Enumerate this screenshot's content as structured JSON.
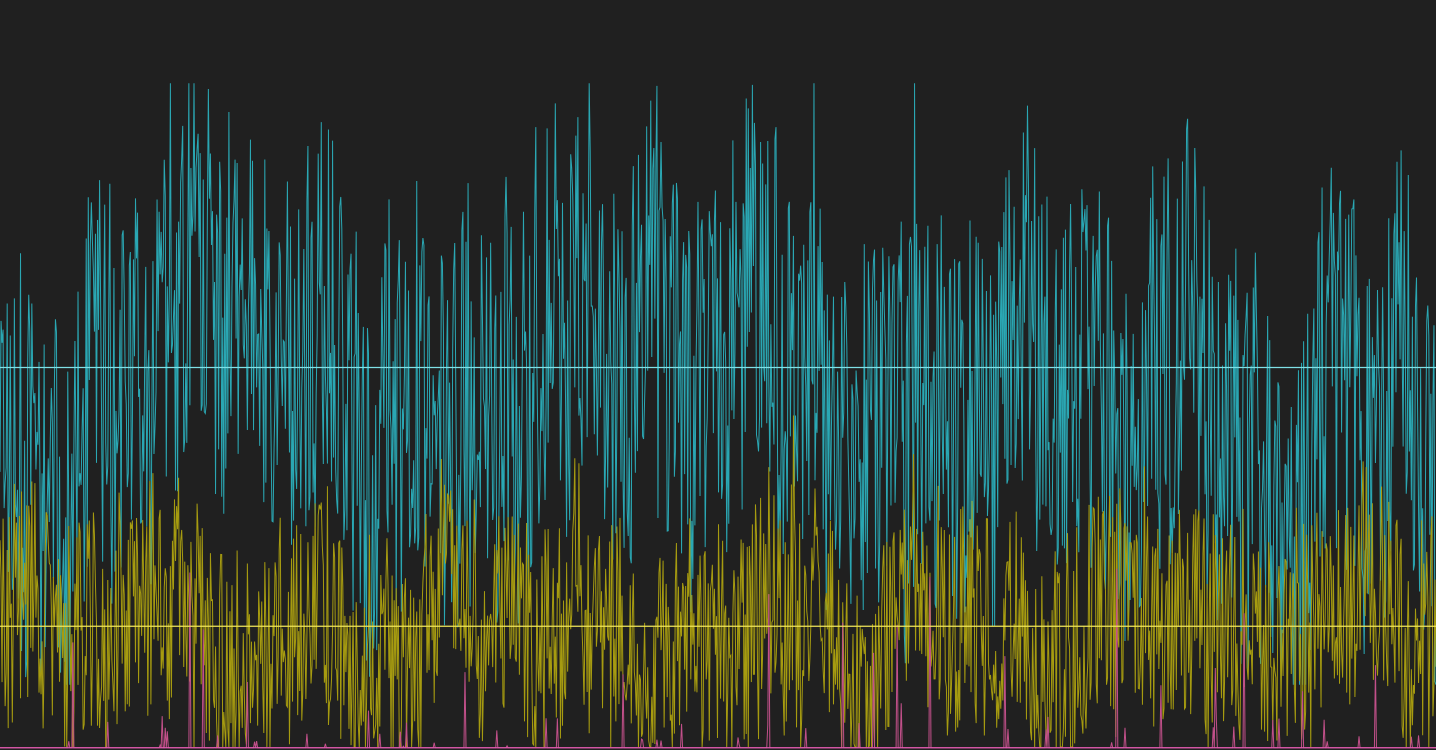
{
  "chart_data": {
    "type": "line",
    "title": "",
    "xlabel": "",
    "ylabel": "",
    "grid": false,
    "legend": "none",
    "background": "#202020",
    "x_range": [
      0,
      1000
    ],
    "ylim": [
      0,
      100
    ],
    "series": [
      {
        "color": "#2aa7b3",
        "mean": 51,
        "spread": 19,
        "peak_max": 88.9,
        "trough_min": 8.7,
        "seed": 11,
        "reference_line": {
          "value": 51,
          "color": "#7fe0e6"
        }
      },
      {
        "color": "#a69b10",
        "mean": 16.5,
        "spread": 11,
        "peak_max": 50.7,
        "trough_min": 0.4,
        "seed": 29,
        "reference_line": {
          "value": 16.5,
          "color": "#f0e65a"
        }
      },
      {
        "color": "#c2508a",
        "mean": 0.3,
        "spread": 0,
        "peak_max": 25,
        "trough_min": 0,
        "seed": 53,
        "sparse_spikes": true,
        "reference_line": {
          "value": 0.3,
          "color": "#e15ab0"
        }
      }
    ]
  }
}
